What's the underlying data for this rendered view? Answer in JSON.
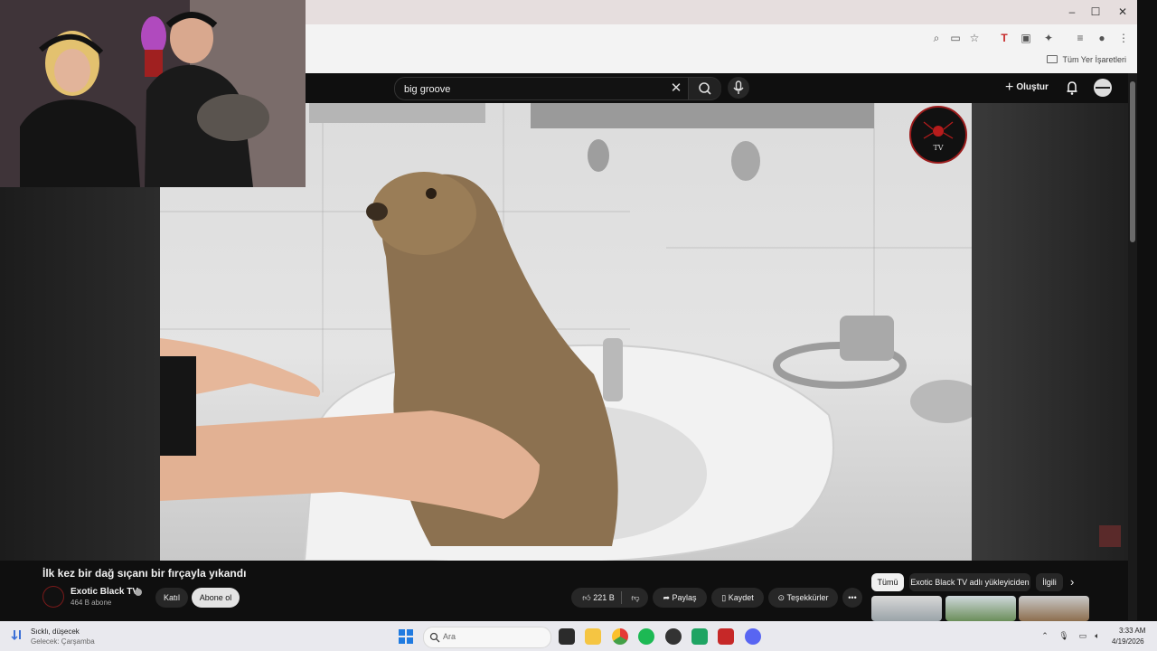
{
  "browser": {
    "window_controls": [
      "–",
      "☐",
      "✕"
    ],
    "bookmarks_all_label": "Tüm Yer İşaretleri",
    "toolbar_icons": [
      "zoom-icon",
      "cast-icon",
      "star-icon",
      "extension-red-icon",
      "extension-gray-icon",
      "puzzle-icon",
      "media-icon",
      "profile-icon",
      "menu-dots-icon"
    ]
  },
  "youtube": {
    "search_value": "big groove",
    "search_clear": "✕",
    "create_label": "Oluştur",
    "video": {
      "title": "İlk kez bir dağ sıçanı bir fırçayla yıkandı",
      "channel_name": "Exotic Black TV",
      "subscribers": "464 B abone",
      "join_label": "Katıl",
      "subscribe_label": "Abone ol",
      "likes": "221 B",
      "share_label": "Paylaş",
      "save_label": "Kaydet",
      "thanks_label": "Teşekkürler",
      "more_label": "•••",
      "overlay_logo_text": "TV"
    },
    "chips": {
      "all": "Tümü",
      "uploader": "Exotic Black TV adlı yükleyiciden",
      "related": "İlgili",
      "next": "›"
    }
  },
  "taskbar": {
    "weather_line1": "Sıcklı, düşecek",
    "weather_line2": "Gelecek: Çarşamba",
    "search_placeholder": "Ara",
    "time": "3:33 AM",
    "date": "4/19/2026"
  },
  "colors": {
    "youtube_bg": "#0f0f0f",
    "chip_active": "#f1f1f1",
    "pill_bg": "#272727",
    "logo_red": "#9b1b1b"
  }
}
